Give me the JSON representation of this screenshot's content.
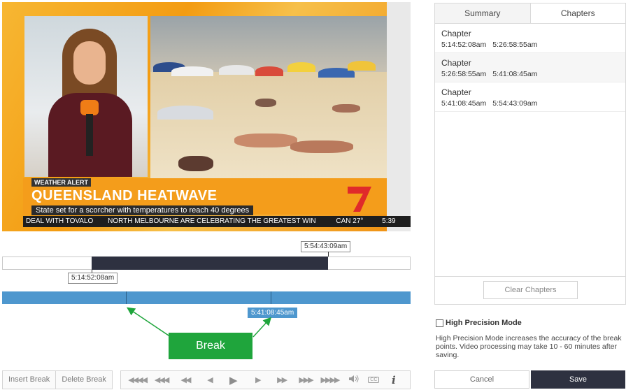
{
  "video": {
    "tag": "WEATHER ALERT",
    "headline": "QUEENSLAND HEATWAVE",
    "subhead": "State set for a scorcher with temperatures to reach 40 degrees",
    "ticker_left": "DEAL WITH TOVALO",
    "ticker_mid": "NORTH MELBOURNE ARE CELEBRATING THE GREATEST WIN",
    "ticker_temp": "CAN 27°",
    "ticker_time": "5:39",
    "logo_icon": "channel-7-logo"
  },
  "timeline": {
    "range_start_label": "5:14:52:08am",
    "range_end_label": "5:54:43:09am",
    "break_label": "5:41:08:45am",
    "callout": "Break"
  },
  "controls": {
    "insert_break": "Insert Break",
    "delete_break": "Delete Break",
    "player_icons": [
      "skip-start-icon",
      "rewind-fast-icon",
      "rewind-icon",
      "step-back-icon",
      "play-icon",
      "step-forward-icon",
      "forward-icon",
      "forward-fast-icon",
      "skip-end-icon",
      "volume-icon",
      "cc-icon",
      "info-icon"
    ],
    "rewind_far": "◀◀◀◀",
    "rewind_fast": "◀◀◀",
    "rewind": "◀◀",
    "step_back": "◀",
    "play": "▶",
    "step_forward": "▶",
    "forward": "▶▶",
    "forward_fast": "▶▶▶",
    "forward_far": "▶▶▶▶",
    "volume": "🔊",
    "cc": "CC",
    "info": "i"
  },
  "panel": {
    "tabs": [
      {
        "label": "Summary",
        "active": false
      },
      {
        "label": "Chapters",
        "active": true
      }
    ],
    "chapters": [
      {
        "title": "Chapter",
        "start": "5:14:52:08am",
        "end": "5:26:58:55am"
      },
      {
        "title": "Chapter",
        "start": "5:26:58:55am",
        "end": "5:41:08:45am"
      },
      {
        "title": "Chapter",
        "start": "5:41:08:45am",
        "end": "5:54:43:09am"
      }
    ],
    "clear_label": "Clear Chapters"
  },
  "precision": {
    "label": "High Precision Mode",
    "checked": false,
    "description": "High Precision Mode increases the accuracy of the break points. Video processing may take 10 - 60 minutes after saving."
  },
  "actions": {
    "cancel": "Cancel",
    "save": "Save"
  },
  "colors": {
    "accent_dark": "#2e3140",
    "segment_blue": "#4e97ce",
    "callout_green": "#1fa53c"
  }
}
